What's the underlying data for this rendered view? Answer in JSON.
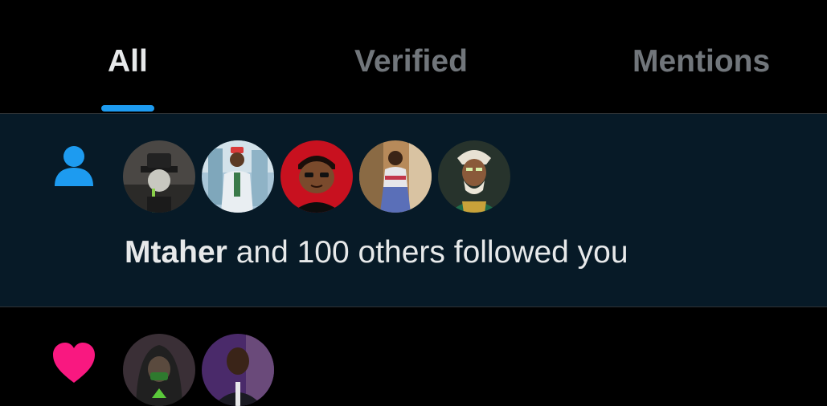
{
  "tabs": [
    {
      "label": "All",
      "active": true
    },
    {
      "label": "Verified",
      "active": false
    },
    {
      "label": "Mentions",
      "active": false
    }
  ],
  "colors": {
    "accent": "#1d9bf0",
    "like": "#f91880",
    "highlight_bg": "#071a27",
    "text_primary": "#e7e9ea",
    "text_secondary": "#71767b"
  },
  "notifications": [
    {
      "type": "follow",
      "icon": "person-icon",
      "avatar_count": 5,
      "name": "Mtaher",
      "text": " and 100 others followed you"
    },
    {
      "type": "like",
      "icon": "heart-icon",
      "avatar_count": 2
    }
  ]
}
